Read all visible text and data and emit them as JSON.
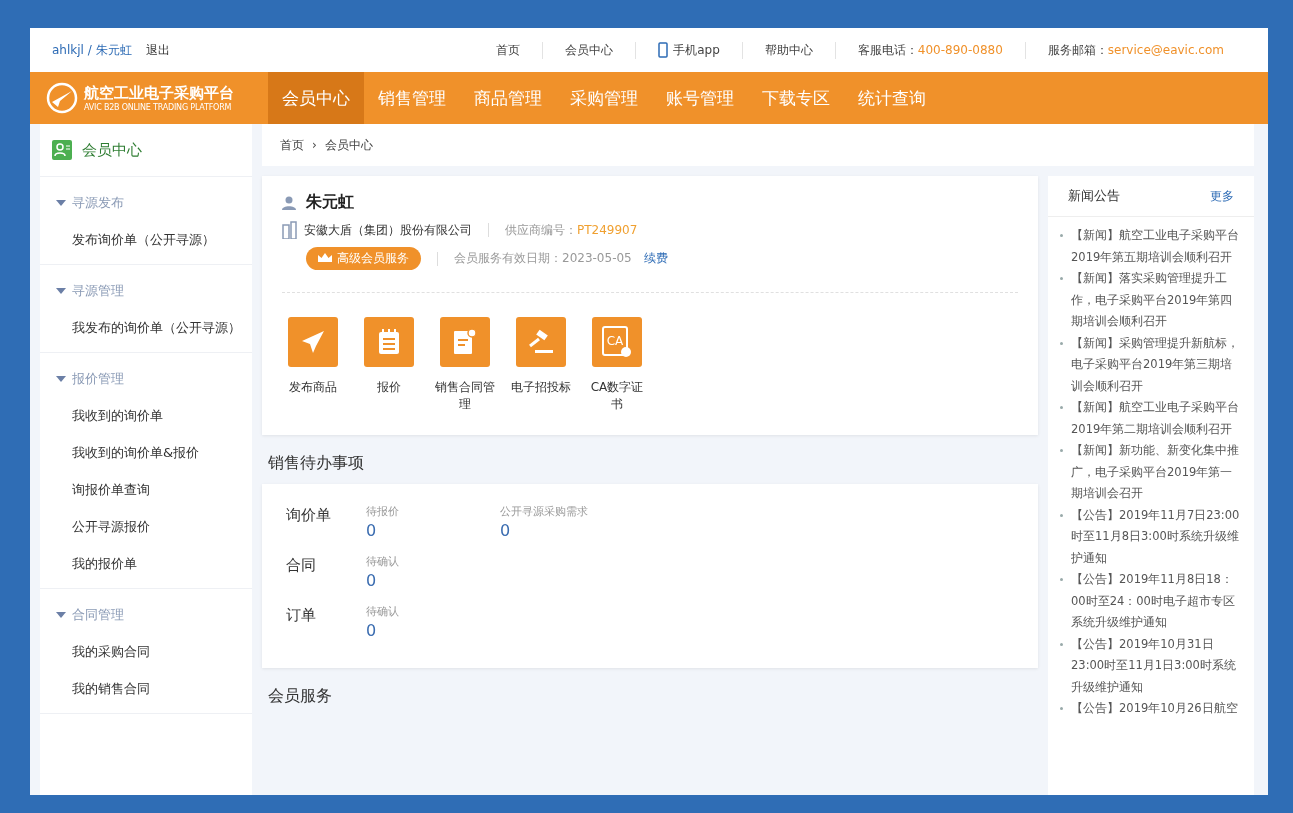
{
  "top_bar": {
    "user": "ahlkjl / 朱元虹",
    "logout": "退出",
    "links": [
      {
        "kind": "link",
        "label": "首页"
      },
      {
        "kind": "link",
        "label": "会员中心"
      },
      {
        "kind": "app",
        "label": "手机app"
      },
      {
        "kind": "link",
        "label": "帮助中心"
      },
      {
        "kind": "contact",
        "label": "客服电话：",
        "value": "400-890-0880"
      },
      {
        "kind": "contact",
        "label": "服务邮箱：",
        "value": "service@eavic.com"
      }
    ]
  },
  "nav": {
    "logo_title": "航空工业电子采购平台",
    "logo_subtitle": "AVIC B2B ONLINE TRADING PLATFORM",
    "items": [
      {
        "label": "会员中心",
        "selected": true
      },
      {
        "label": "销售管理",
        "selected": false
      },
      {
        "label": "商品管理",
        "selected": false
      },
      {
        "label": "采购管理",
        "selected": false
      },
      {
        "label": "账号管理",
        "selected": false
      },
      {
        "label": "下载专区",
        "selected": false
      },
      {
        "label": "统计查询",
        "selected": false
      }
    ]
  },
  "sidebar": {
    "title": "会员中心",
    "groups": [
      {
        "title": "寻源发布",
        "expanded": true,
        "items": [
          "发布询价单（公开寻源）"
        ]
      },
      {
        "title": "寻源管理",
        "expanded": true,
        "items": [
          "我发布的询价单（公开寻源）"
        ]
      },
      {
        "title": "报价管理",
        "expanded": true,
        "items": [
          "我收到的询价单",
          "我收到的询价单&报价",
          "询报价单查询",
          "公开寻源报价",
          "我的报价单"
        ]
      },
      {
        "title": "合同管理",
        "expanded": true,
        "items": [
          "我的采购合同",
          "我的销售合同"
        ]
      }
    ]
  },
  "breadcrumb": {
    "items": [
      "首页",
      "会员中心"
    ],
    "separator": "›"
  },
  "profile": {
    "name": "朱元虹",
    "company": "安徽大盾（集团）股份有限公司",
    "supplier_label": "供应商编号：",
    "supplier_code": "PT249907",
    "badge": "高级会员服务",
    "validity": "会员服务有效日期：2023-05-05",
    "renew": "续费"
  },
  "quick_actions": [
    {
      "kind": "send",
      "label": "发布商品"
    },
    {
      "kind": "notepad",
      "label": "报价"
    },
    {
      "kind": "document",
      "label": "销售合同管理"
    },
    {
      "kind": "gavel",
      "label": "电子招投标"
    },
    {
      "kind": "certificate",
      "label": "CA数字证书",
      "icon_text": "CA"
    }
  ],
  "todo": {
    "title": "销售待办事项",
    "rows": [
      {
        "label": "询价单",
        "stats": [
          {
            "label": "待报价",
            "value": "0"
          },
          {
            "label": "公开寻源采购需求",
            "value": "0"
          }
        ]
      },
      {
        "label": "合同",
        "stats": [
          {
            "label": "待确认",
            "value": "0"
          }
        ]
      },
      {
        "label": "订单",
        "stats": [
          {
            "label": "待确认",
            "value": "0"
          }
        ]
      }
    ]
  },
  "member_services": {
    "title": "会员服务"
  },
  "news": {
    "title": "新闻公告",
    "more": "更多",
    "items": [
      "【新闻】航空工业电子采购平台2019年第五期培训会顺利召开",
      "【新闻】落实采购管理提升工作，电子采购平台2019年第四期培训会顺利召开",
      "【新闻】采购管理提升新航标，电子采购平台2019年第三期培训会顺利召开",
      "【新闻】航空工业电子采购平台2019年第二期培训会顺利召开",
      "【新闻】新功能、新变化集中推广，电子采购平台2019年第一期培训会召开",
      "【公告】2019年11月7日23:00时至11月8日3:00时系统升级维护通知",
      "【公告】2019年11月8日18：00时至24：00时电子超市专区系统升级维护通知",
      "【公告】2019年10月31日23:00时至11月1日3:00时系统升级维护通知",
      "【公告】2019年10月26日航空"
    ]
  }
}
